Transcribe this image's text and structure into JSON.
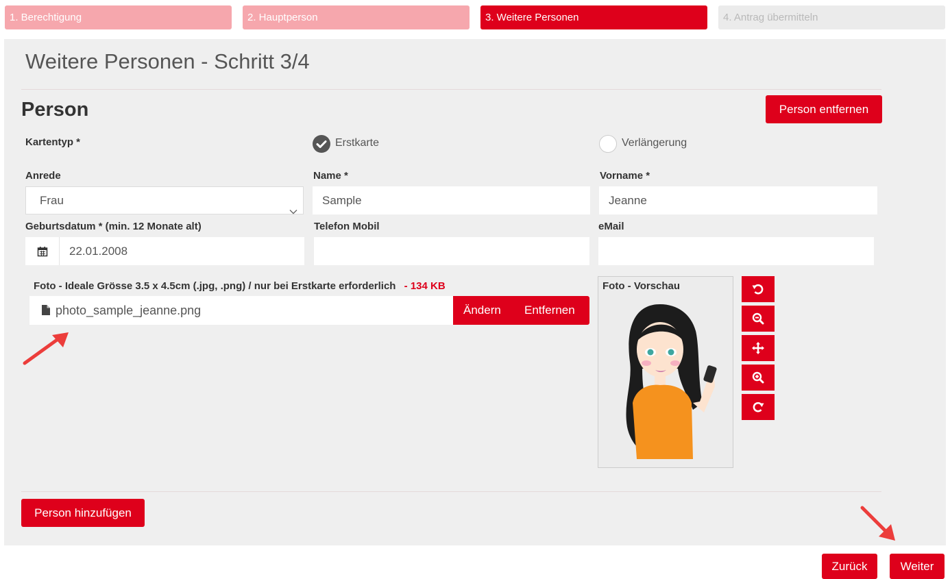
{
  "steps": [
    {
      "label": "1. Berechtigung",
      "state": "done"
    },
    {
      "label": "2. Hauptperson",
      "state": "done"
    },
    {
      "label": "3. Weitere Personen",
      "state": "active"
    },
    {
      "label": "4. Antrag übermitteln",
      "state": "todo"
    }
  ],
  "page": {
    "title": "Weitere Personen - Schritt 3/4"
  },
  "person": {
    "section_title": "Person",
    "remove_button": "Person entfernen",
    "kartentyp": {
      "label": "Kartentyp *",
      "options": [
        {
          "label": "Erstkarte",
          "checked": true
        },
        {
          "label": "Verlängerung",
          "checked": false
        }
      ]
    },
    "anrede": {
      "label": "Anrede",
      "value": "Frau"
    },
    "name": {
      "label": "Name *",
      "value": "Sample"
    },
    "vorname": {
      "label": "Vorname *",
      "value": "Jeanne"
    },
    "geburtsdatum": {
      "label": "Geburtsdatum * (min. 12 Monate alt)",
      "value": "22.01.2008",
      "icon": "calendar-icon"
    },
    "telefon": {
      "label": "Telefon Mobil",
      "value": ""
    },
    "email": {
      "label": "eMail",
      "value": ""
    },
    "foto": {
      "label": "Foto - Ideale Grösse 3.5 x 4.5cm (.jpg, .png) / nur bei Erstkarte erforderlich",
      "size": "- 134 KB",
      "filename": "photo_sample_jeanne.png",
      "change_button": "Ändern",
      "remove_button": "Entfernen"
    },
    "preview": {
      "label": "Foto - Vorschau",
      "tools": [
        "rotate-left-icon",
        "zoom-out-icon",
        "move-icon",
        "zoom-in-icon",
        "rotate-right-icon"
      ]
    }
  },
  "add_person_button": "Person hinzufügen",
  "nav": {
    "back": "Zurück",
    "next": "Weiter"
  },
  "colors": {
    "accent": "#de001b",
    "step_done": "#f6a7ad",
    "step_todo": "#ebebeb",
    "panel": "#efefef",
    "arrow": "#ec3d3b"
  }
}
